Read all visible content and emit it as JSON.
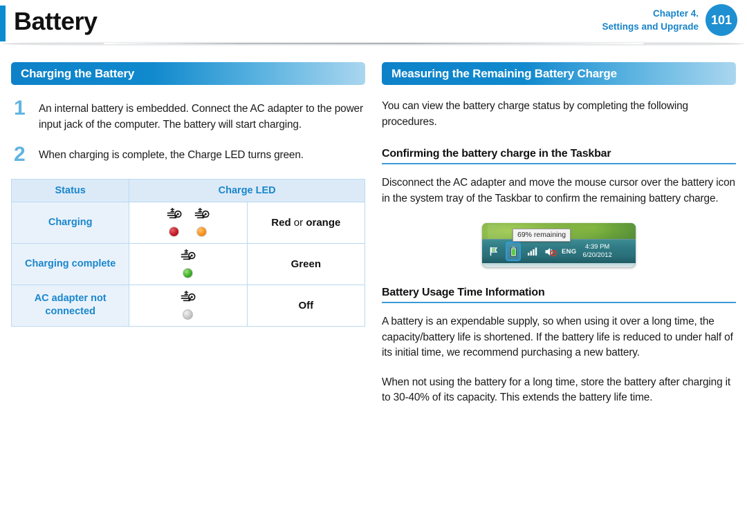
{
  "header": {
    "title": "Battery",
    "chapter_line1": "Chapter 4.",
    "chapter_line2": "Settings and Upgrade",
    "page_number": "101"
  },
  "left_column": {
    "section_title": "Charging the Battery",
    "steps": [
      {
        "number": "1",
        "text": "An internal battery is embedded. Connect the AC adapter to the power input jack of the computer. The battery will start charging."
      },
      {
        "number": "2",
        "text": "When charging is complete, the Charge LED turns green."
      }
    ],
    "table": {
      "headers": [
        "Status",
        "Charge LED"
      ],
      "rows": [
        {
          "status": "Charging",
          "leds": [
            {
              "icon": "charge-led-icon",
              "dot_color": "#c21b28",
              "dot_class": "dot-red"
            },
            {
              "icon": "charge-led-icon",
              "dot_color": "#f7921e",
              "dot_class": "dot-orange"
            }
          ],
          "color_label_bold1": "Red",
          "color_label_thin": " or ",
          "color_label_bold2": "orange"
        },
        {
          "status": "Charging complete",
          "leds": [
            {
              "icon": "charge-led-icon",
              "dot_color": "#3fae2a",
              "dot_class": "dot-green"
            }
          ],
          "color_label": "Green"
        },
        {
          "status": "AC adapter not connected",
          "leds": [
            {
              "icon": "charge-led-icon",
              "dot_color": "#c9c9c9",
              "dot_class": "dot-gray"
            }
          ],
          "color_label": "Off"
        }
      ]
    }
  },
  "right_column": {
    "section_title": "Measuring the Remaining Battery Charge",
    "intro": "You can view the battery charge status by completing the following procedures.",
    "subhead_1": "Confirming the battery charge in the Taskbar",
    "para_1": "Disconnect the AC adapter and move the mouse cursor over the battery icon in the system tray of the Taskbar to confirm the remaining battery charge.",
    "taskbar_screenshot": {
      "tooltip": "69% remaining",
      "icons": [
        "flag-icon",
        "battery-icon",
        "network-icon",
        "volume-muted-icon"
      ],
      "language": "ENG",
      "time": "4:39 PM",
      "date": "6/20/2012",
      "highlight_color": "#2e9bdc"
    },
    "subhead_2": "Battery Usage Time Information",
    "para_2": "A battery is an expendable supply, so when using it over a long time, the capacity/battery life is shortened. If the battery life is reduced to under half of its initial time, we recommend purchasing a new battery.",
    "para_3": "When not using the battery for a long time, store the battery after charging it to 30-40% of its capacity. This extends the battery life time."
  },
  "colors": {
    "accent_blue": "#0b8cd0",
    "section_bar_start": "#0d82c9",
    "section_bar_end": "#aad6ef",
    "table_header_bg": "#dceaf8",
    "table_status_bg": "#e9f2fb",
    "table_text_blue": "#1a86cc",
    "step_number": "#62b4e0"
  }
}
